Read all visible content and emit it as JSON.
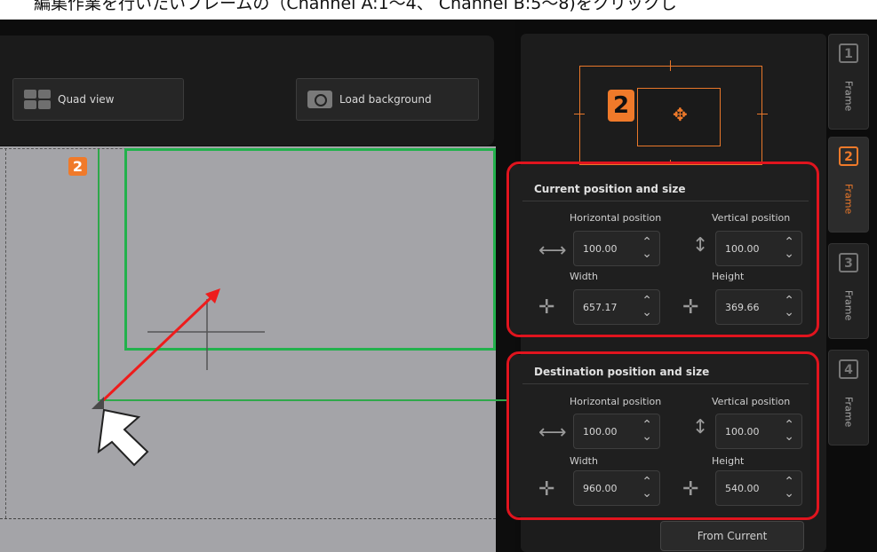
{
  "caption": "編集作業を行いたいフレームの（Channel A:1～4、 Channel B:5～8)をクリックし",
  "toolbar": {
    "quad_view_label": "Quad view",
    "load_background_label": "Load background"
  },
  "canvas": {
    "frame_badge": "2"
  },
  "preview": {
    "badge": "2",
    "move_glyph": "✥"
  },
  "current": {
    "title": "Current position and size",
    "h_label": "Horizontal position",
    "v_label": "Vertical position",
    "w_label": "Width",
    "hgt_label": "Height",
    "h_value": "100.00",
    "v_value": "100.00",
    "w_value": "657.17",
    "hgt_value": "369.66"
  },
  "destination": {
    "title": "Destination position and size",
    "h_label": "Horizontal position",
    "v_label": "Vertical position",
    "w_label": "Width",
    "hgt_label": "Height",
    "h_value": "100.00",
    "v_value": "100.00",
    "w_value": "960.00",
    "hgt_value": "540.00"
  },
  "from_current_label": "From Current",
  "tabs": [
    {
      "num": "1",
      "label": "Frame"
    },
    {
      "num": "2",
      "label": "Frame"
    },
    {
      "num": "3",
      "label": "Frame"
    },
    {
      "num": "4",
      "label": "Frame"
    }
  ],
  "colors": {
    "accent": "#f07a2a",
    "selection_green": "#22b14c",
    "highlight_red": "#e0141e"
  }
}
